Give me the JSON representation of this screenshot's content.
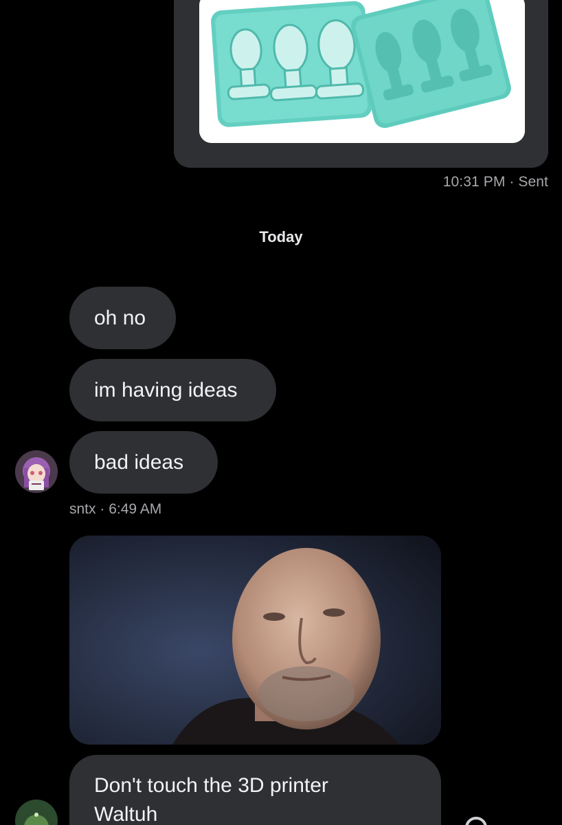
{
  "sent": {
    "image_alt": "teal silicone mold tray",
    "time": "10:31 PM",
    "status_sep": "·",
    "status": "Sent"
  },
  "divider": {
    "label": "Today"
  },
  "messages": [
    {
      "text": "oh no"
    },
    {
      "text": "im having ideas"
    },
    {
      "text": "bad ideas"
    }
  ],
  "sender": {
    "name": "sntx",
    "sep": "·",
    "time": "6:49 AM",
    "avatar_icon": "anime-avatar-icon"
  },
  "received_image": {
    "alt": "portrait photo of a bald man"
  },
  "last_message": {
    "line1": "Don't touch the 3D printer",
    "line2": "Waltuh"
  },
  "colors": {
    "background": "#000000",
    "bubble": "#2f3033",
    "meta_text": "#a8a8ad",
    "mold_teal": "#6fd6c8"
  }
}
